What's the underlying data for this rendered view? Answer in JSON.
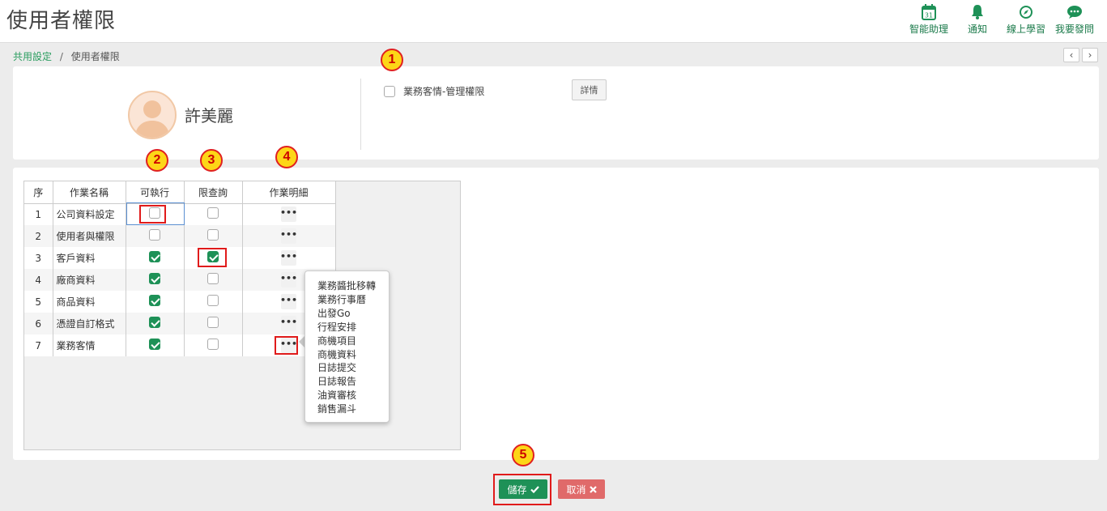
{
  "page": {
    "title": "使用者權限"
  },
  "top_actions": [
    {
      "label": "智能助理",
      "icon": "calendar-icon",
      "calendar_day": "31"
    },
    {
      "label": "通知",
      "icon": "bell-icon"
    },
    {
      "label": "線上學習",
      "icon": "compass-icon"
    },
    {
      "label": "我要發問",
      "icon": "chat-icon"
    }
  ],
  "breadcrumb": {
    "parent": "共用設定",
    "separator": "/",
    "current": "使用者權限"
  },
  "pager": {
    "prev": "‹",
    "next": "›"
  },
  "user": {
    "name": "許美麗"
  },
  "admin_permission": {
    "label": "業務客情-管理權限",
    "checked": false,
    "detail_button": "詳情"
  },
  "table": {
    "headers": [
      "序",
      "作業名稱",
      "可執行",
      "限查詢",
      "作業明細"
    ],
    "rows": [
      {
        "seq": "1",
        "name": "公司資料設定",
        "exec": false,
        "query": false,
        "detail": "•••"
      },
      {
        "seq": "2",
        "name": "使用者與權限",
        "exec": false,
        "query": false,
        "detail": "•••"
      },
      {
        "seq": "3",
        "name": "客戶資料",
        "exec": true,
        "query": true,
        "detail": "•••"
      },
      {
        "seq": "4",
        "name": "廠商資料",
        "exec": true,
        "query": false,
        "detail": "•••"
      },
      {
        "seq": "5",
        "name": "商品資料",
        "exec": true,
        "query": false,
        "detail": "•••"
      },
      {
        "seq": "6",
        "name": "憑證自訂格式",
        "exec": true,
        "query": false,
        "detail": "•••"
      },
      {
        "seq": "7",
        "name": "業務客情",
        "exec": true,
        "query": false,
        "detail": "•••"
      }
    ]
  },
  "detail_popup": {
    "items": [
      "業務醬批移轉",
      "業務行事曆",
      "出發Go",
      "行程安排",
      "商機項目",
      "商機資料",
      "日誌提交",
      "日誌報告",
      "油資審核",
      "銷售漏斗"
    ]
  },
  "badges": [
    "1",
    "2",
    "3",
    "4",
    "5"
  ],
  "buttons": {
    "save": "儲存",
    "cancel": "取消"
  },
  "colors": {
    "accent": "#1e9157",
    "danger": "#e06a6a",
    "badge_fill": "#fdd617",
    "badge_border": "#e02020",
    "highlight": "#e01b1b"
  }
}
